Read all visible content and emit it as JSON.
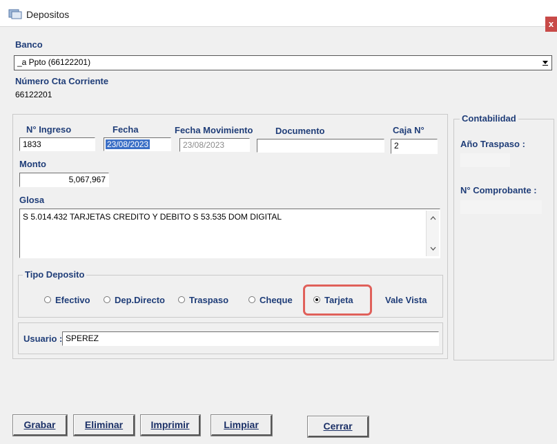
{
  "window": {
    "title": "Depositos",
    "close_glyph": "x"
  },
  "banco": {
    "label": "Banco",
    "value": "_a Ppto (66122201)"
  },
  "cuenta": {
    "label": "Número Cta Corriente",
    "value": "66122201"
  },
  "fields": {
    "ingreso": {
      "label": "N° Ingreso",
      "value": "1833"
    },
    "fecha": {
      "label": "Fecha",
      "value": "23/08/2023"
    },
    "fecha_mov": {
      "label": "Fecha Movimiento",
      "value": "23/08/2023"
    },
    "documento": {
      "label": "Documento",
      "value": ""
    },
    "caja": {
      "label": "Caja N°",
      "value": "2"
    },
    "monto": {
      "label": "Monto",
      "value": "5,067,967"
    },
    "glosa": {
      "label": "Glosa",
      "value": "S 5.014.432 TARJETAS CREDITO Y DEBITO S 53.535 DOM DIGITAL"
    }
  },
  "contabilidad": {
    "legend": "Contabilidad",
    "anio_label": "Año Traspaso :",
    "anio_value": "",
    "comprobante_label": "N° Comprobante :",
    "comprobante_value": ""
  },
  "tipo_deposito": {
    "legend": "Tipo Deposito",
    "options": [
      "Efectivo",
      "Dep.Directo",
      "Traspaso",
      "Cheque",
      "Tarjeta",
      "Vale Vista"
    ],
    "selected": "Tarjeta"
  },
  "usuario": {
    "label": "Usuario :",
    "value": "SPEREZ"
  },
  "buttons": {
    "grabar": "Grabar",
    "eliminar": "Eliminar",
    "imprimir": "Imprimir",
    "limpiar": "Limpiar",
    "cerrar": "Cerrar"
  },
  "icons": {
    "dropdown": "chevron-down-icon",
    "scroll_up": "scroll-up-icon",
    "scroll_down": "scroll-down-icon",
    "app": "app-icon"
  },
  "colors": {
    "label": "#1f3d78",
    "highlight": "#e0605a",
    "selection": "#3b6fc6"
  }
}
